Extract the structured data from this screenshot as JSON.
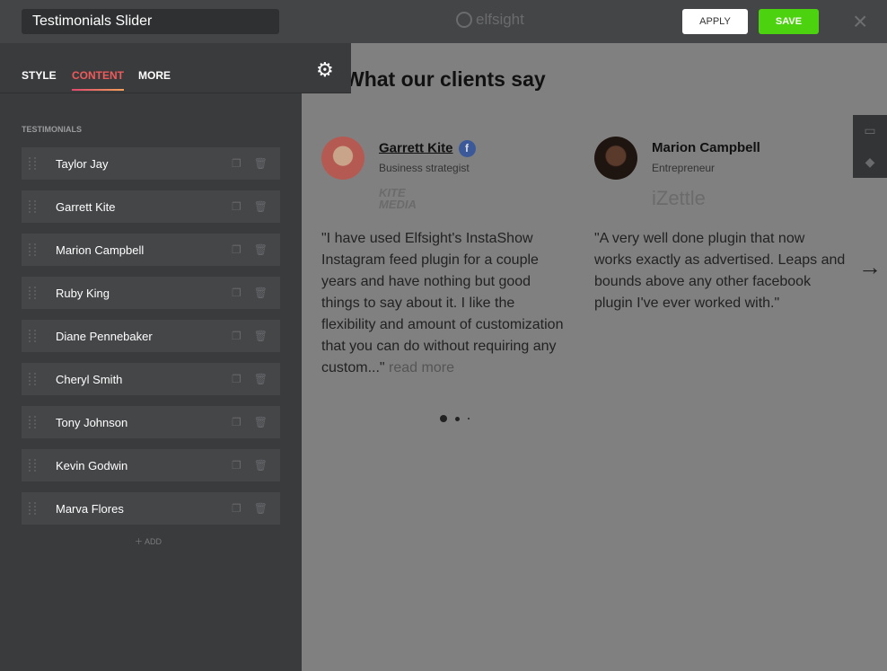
{
  "header": {
    "title": "Testimonials Slider",
    "logo": "elfsight",
    "apply_label": "APPLY",
    "save_label": "SAVE",
    "close_icon": "×",
    "colors": {
      "save": "#4cd20e"
    }
  },
  "sidebar": {
    "tabs": [
      {
        "label": "STYLE"
      },
      {
        "label": "CONTENT",
        "active": true
      },
      {
        "label": "MORE"
      }
    ],
    "section_label": "TESTIMONIALS",
    "items": [
      {
        "label": "Taylor Jay"
      },
      {
        "label": "Garrett Kite"
      },
      {
        "label": "Marion Campbell"
      },
      {
        "label": "Ruby King"
      },
      {
        "label": "Diane Pennebaker"
      },
      {
        "label": "Cheryl Smith"
      },
      {
        "label": "Tony Johnson"
      },
      {
        "label": "Kevin Godwin"
      },
      {
        "label": "Marva Flores"
      }
    ],
    "add_label": "ADD"
  },
  "preview": {
    "heading": "What our clients say",
    "cards": [
      {
        "name": "Garrett Kite",
        "role": "Business strategist",
        "company": "KITE MEDIA",
        "quote": "\"I have used Elfsight's InstaShow Instagram feed plugin for a couple years and have nothing but good things to say about it. I like the flexibility and amount of customization that you can do without requiring any custom...\"",
        "read_more": "read more",
        "source_icon": "facebook-icon"
      },
      {
        "name": "Marion Campbell",
        "role": "Entrepreneur",
        "company": "iZettle",
        "quote": "\"A very well done plugin that now works exactly as advertised. Leaps and bounds above any other facebook plugin I've ever worked with.\""
      }
    ],
    "pagination": {
      "pages": 3,
      "current": 1
    }
  }
}
